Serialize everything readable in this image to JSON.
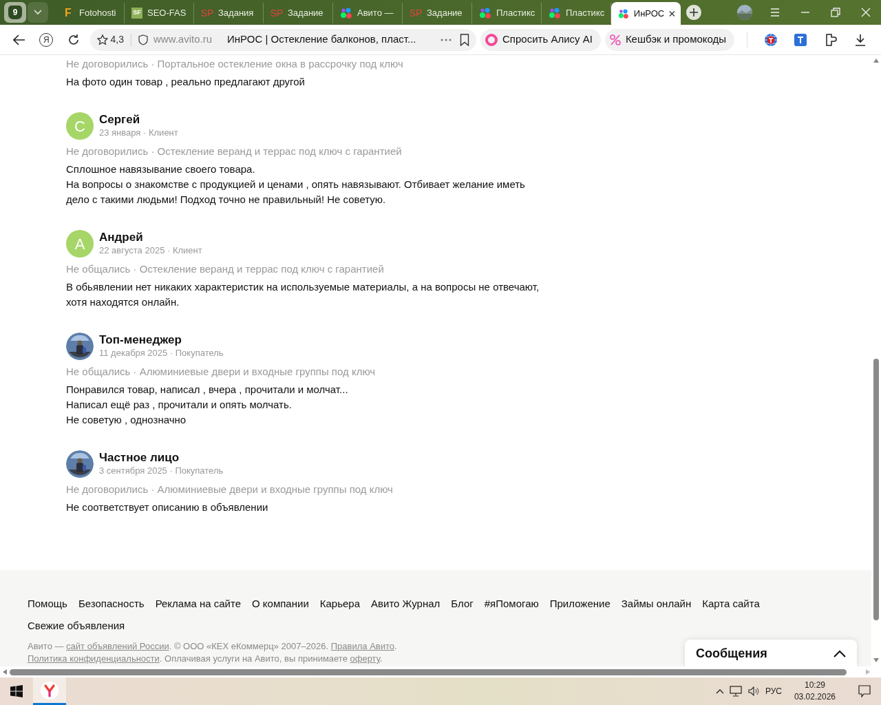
{
  "browser": {
    "tab_count": "9",
    "tabs": [
      {
        "favicon": {
          "kind": "letter",
          "text": "F"
        },
        "title": "Fotohosti",
        "selected": false
      },
      {
        "favicon": {
          "kind": "square",
          "text": "SF"
        },
        "title": "SEO-FAS",
        "selected": false
      },
      {
        "favicon": {
          "kind": "duo",
          "text": "SP"
        },
        "title": "Задания",
        "selected": false
      },
      {
        "favicon": {
          "kind": "duo",
          "text": "SP"
        },
        "title": "Задание",
        "selected": false
      },
      {
        "favicon": {
          "kind": "dots"
        },
        "title": "Авито —",
        "selected": false
      },
      {
        "favicon": {
          "kind": "duo",
          "text": "SP"
        },
        "title": "Задание",
        "selected": false
      },
      {
        "favicon": {
          "kind": "dots"
        },
        "title": "Пластикс",
        "selected": false
      },
      {
        "favicon": {
          "kind": "dots"
        },
        "title": "Пластикс",
        "selected": false
      },
      {
        "favicon": {
          "kind": "dots"
        },
        "title": "ИнРОС",
        "selected": true
      }
    ]
  },
  "toolbar": {
    "yandex_button": "Я",
    "rating": "4,3",
    "domain": "www.avito.ru",
    "page_title": "ИнРОС | Остекление балконов, пласт...",
    "alice_button": "Спросить Алису AI",
    "cashback_button": "Кешбэк и промокоды"
  },
  "reviews": [
    {
      "deal": "Не договорились · Портальное остекление окна в рассрочку под ключ",
      "text": [
        "На фото один товар , реально предлагают другой"
      ]
    },
    {
      "author": {
        "name": "Сергей",
        "meta": "23 января · Клиент",
        "avatar": {
          "kind": "letter",
          "text": "С",
          "color": "#a5d667"
        }
      },
      "deal": "Не договорились · Остекление веранд и террас под ключ с гарантией",
      "text": [
        "Сплошное навязывание своего товара.",
        "На вопросы о знакомстве с продукцией и ценами , опять навязывают. Отбивает желание иметь дело с такими людьми! Подход точно не правильный! Не советую."
      ]
    },
    {
      "author": {
        "name": "Андрей",
        "meta": "22 августа 2025 · Клиент",
        "avatar": {
          "kind": "letter",
          "text": "А",
          "color": "#a5d667"
        }
      },
      "deal": "Не общались · Остекление веранд и террас под ключ с гарантией",
      "text": [
        "В обьявлении нет никаких характеристик на используемые материалы, а на вопросы не отвечают, хотя находятся онлайн."
      ]
    },
    {
      "author": {
        "name": "Топ-менеджер",
        "meta": "11 декабря 2025 · Покупатель"
      },
      "deal": "Не общались · Алюминиевые двери и входные группы под ключ",
      "text": [
        "Понравился товар, написал , вчера , прочитали и молчат...",
        "Написал ещё раз , прочитали и опять молчать.",
        "Не советую , однозначно"
      ]
    },
    {
      "author": {
        "name": "Частное лицо",
        "meta": "3 сентября 2025 · Покупатель"
      },
      "deal": "Не договорились · Алюминиевые двери и входные группы под ключ",
      "text": [
        "Не соответствует описанию в объявлении"
      ]
    }
  ],
  "footer": {
    "link_rows": [
      [
        "Помощь",
        "Безопасность",
        "Реклама на сайте",
        "О компании",
        "Карьера",
        "Авито Журнал",
        "Блог",
        "#яПомогаю",
        "Приложение",
        "Займы онлайн",
        "Карта сайта"
      ],
      [
        "Свежие объявления"
      ]
    ],
    "legal": [
      [
        {
          "text": "Авито — ",
          "kind": "text"
        },
        {
          "text": "сайт объявлений России",
          "kind": "link"
        },
        {
          "text": ". © ООО «КЕХ еКоммерц» 2007–2026. ",
          "kind": "text"
        },
        {
          "text": "Правила Авито",
          "kind": "link"
        },
        {
          "text": ".",
          "kind": "text"
        }
      ],
      [
        {
          "text": "Политика конфиденциальности",
          "kind": "link"
        },
        {
          "text": ". Оплачивая услуги на Авито, вы принимаете ",
          "kind": "text"
        },
        {
          "text": "оферту",
          "kind": "link"
        },
        {
          "text": ".",
          "kind": "text"
        }
      ]
    ]
  },
  "messages_widget": {
    "title": "Сообщения"
  },
  "taskbar": {
    "language": "РУС",
    "time": "10:29",
    "date": "03.02.2026"
  }
}
